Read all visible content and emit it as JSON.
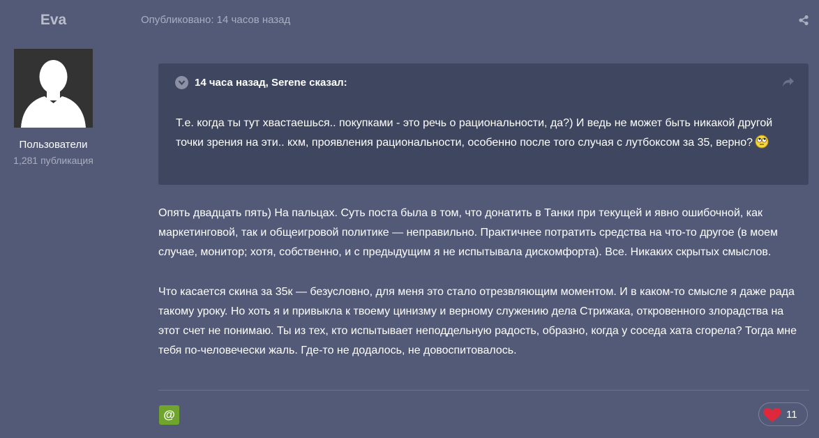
{
  "author": {
    "name": "Eva",
    "group": "Пользователи",
    "posts": "1,281 публикация"
  },
  "post": {
    "date": "Опубликовано: 14 часов назад",
    "quote": {
      "citation": "14 часа назад, Serene сказал:",
      "text": "Т.е. когда ты тут хвастаешься.. покупками - это речь о рациональности, да?) И ведь не может быть никакой другой точки зрения на эти.. кхм, проявления рациональности, особенно после того случая с лутбоксом за 35, верно?",
      "emoji": "rolling-eyes-emoji"
    },
    "paragraphs": [
      "Опять двадцать пять) На пальцах. Суть поста была в том, что донатить в Танки при текущей и явно ошибочной, как маркетинговой, так и общеигровой политике — неправильно. Практичнее потратить средства на что-то другое (в моем случае, монитор; хотя, собственно, и с предыдущим я не испытывала дискомфорта). Все. Никаких скрытых смыслов.",
      "Что касается скина за 35к — безусловно, для меня это стало отрезвляющим моментом. И в каком-то смысле я даже рада такому уроку. Но хоть я и привыкла к твоему цинизму и верному служению дела Стрижака, откровенного злорадства на этот счет не понимаю. Ты из тех, кто испытывает неподдельную радость, образно, когда у соседа хата сгорела? Тогда мне тебя по-человечески жаль. Где-то не додалось, не довоспитовалось."
    ],
    "mention_label": "@",
    "reaction_count": "11"
  },
  "icons": {
    "share": "share-icon",
    "quote_toggle": "chevron-down-icon",
    "quote_jump": "reply-arrow-icon",
    "reaction": "heart-icon"
  },
  "colors": {
    "background": "#525a78",
    "quote_background": "#3f465f",
    "mention_green": "#6fa52c",
    "heart_red": "#e0283c"
  }
}
